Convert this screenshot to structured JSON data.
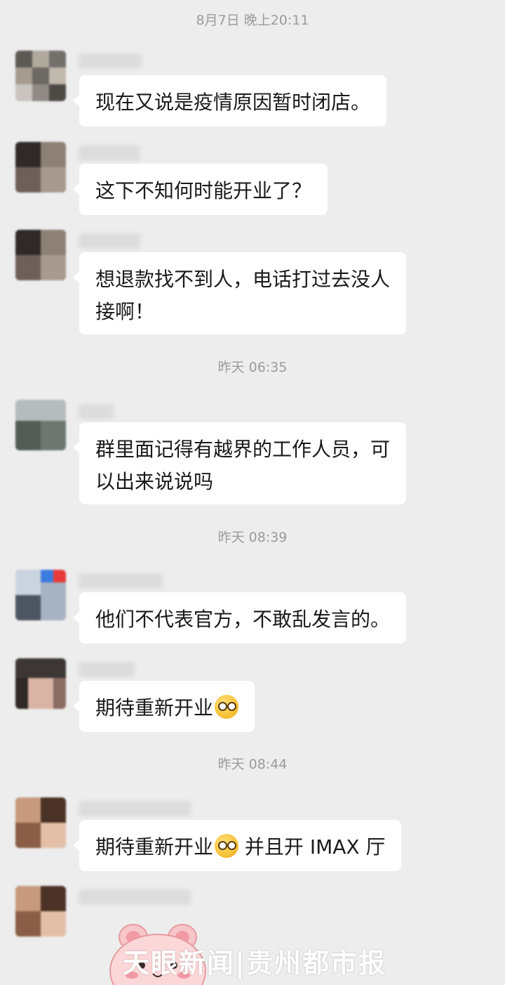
{
  "timestamps": [
    "8月7日 晚上20:11",
    "昨天 06:35",
    "昨天 08:39",
    "昨天 08:44"
  ],
  "messages": [
    {
      "text": "现在又说是疫情原因暂时闭店。"
    },
    {
      "text": "这下不知何时能开业了？"
    },
    {
      "line1": "想退款找不到人，电话打过去没人",
      "line2": "接啊！"
    },
    {
      "line1": "群里面记得有越界的工作人员，可",
      "line2": "以出来说说吗"
    },
    {
      "text": "他们不代表官方，不敢乱发言的。"
    },
    {
      "text": "期待重新开业",
      "emoji": "grimace-emoji"
    },
    {
      "text_a": "期待重新开业",
      "emoji": "grimace-emoji",
      "text_b": " 并且开 IMAX 厅"
    }
  ],
  "watermark": {
    "text": "天眼新闻|贵州都市报"
  },
  "colors": {
    "background": "#ededed",
    "bubble": "#ffffff",
    "timestamp": "#9b9b9b",
    "text": "#1a1a1a"
  }
}
